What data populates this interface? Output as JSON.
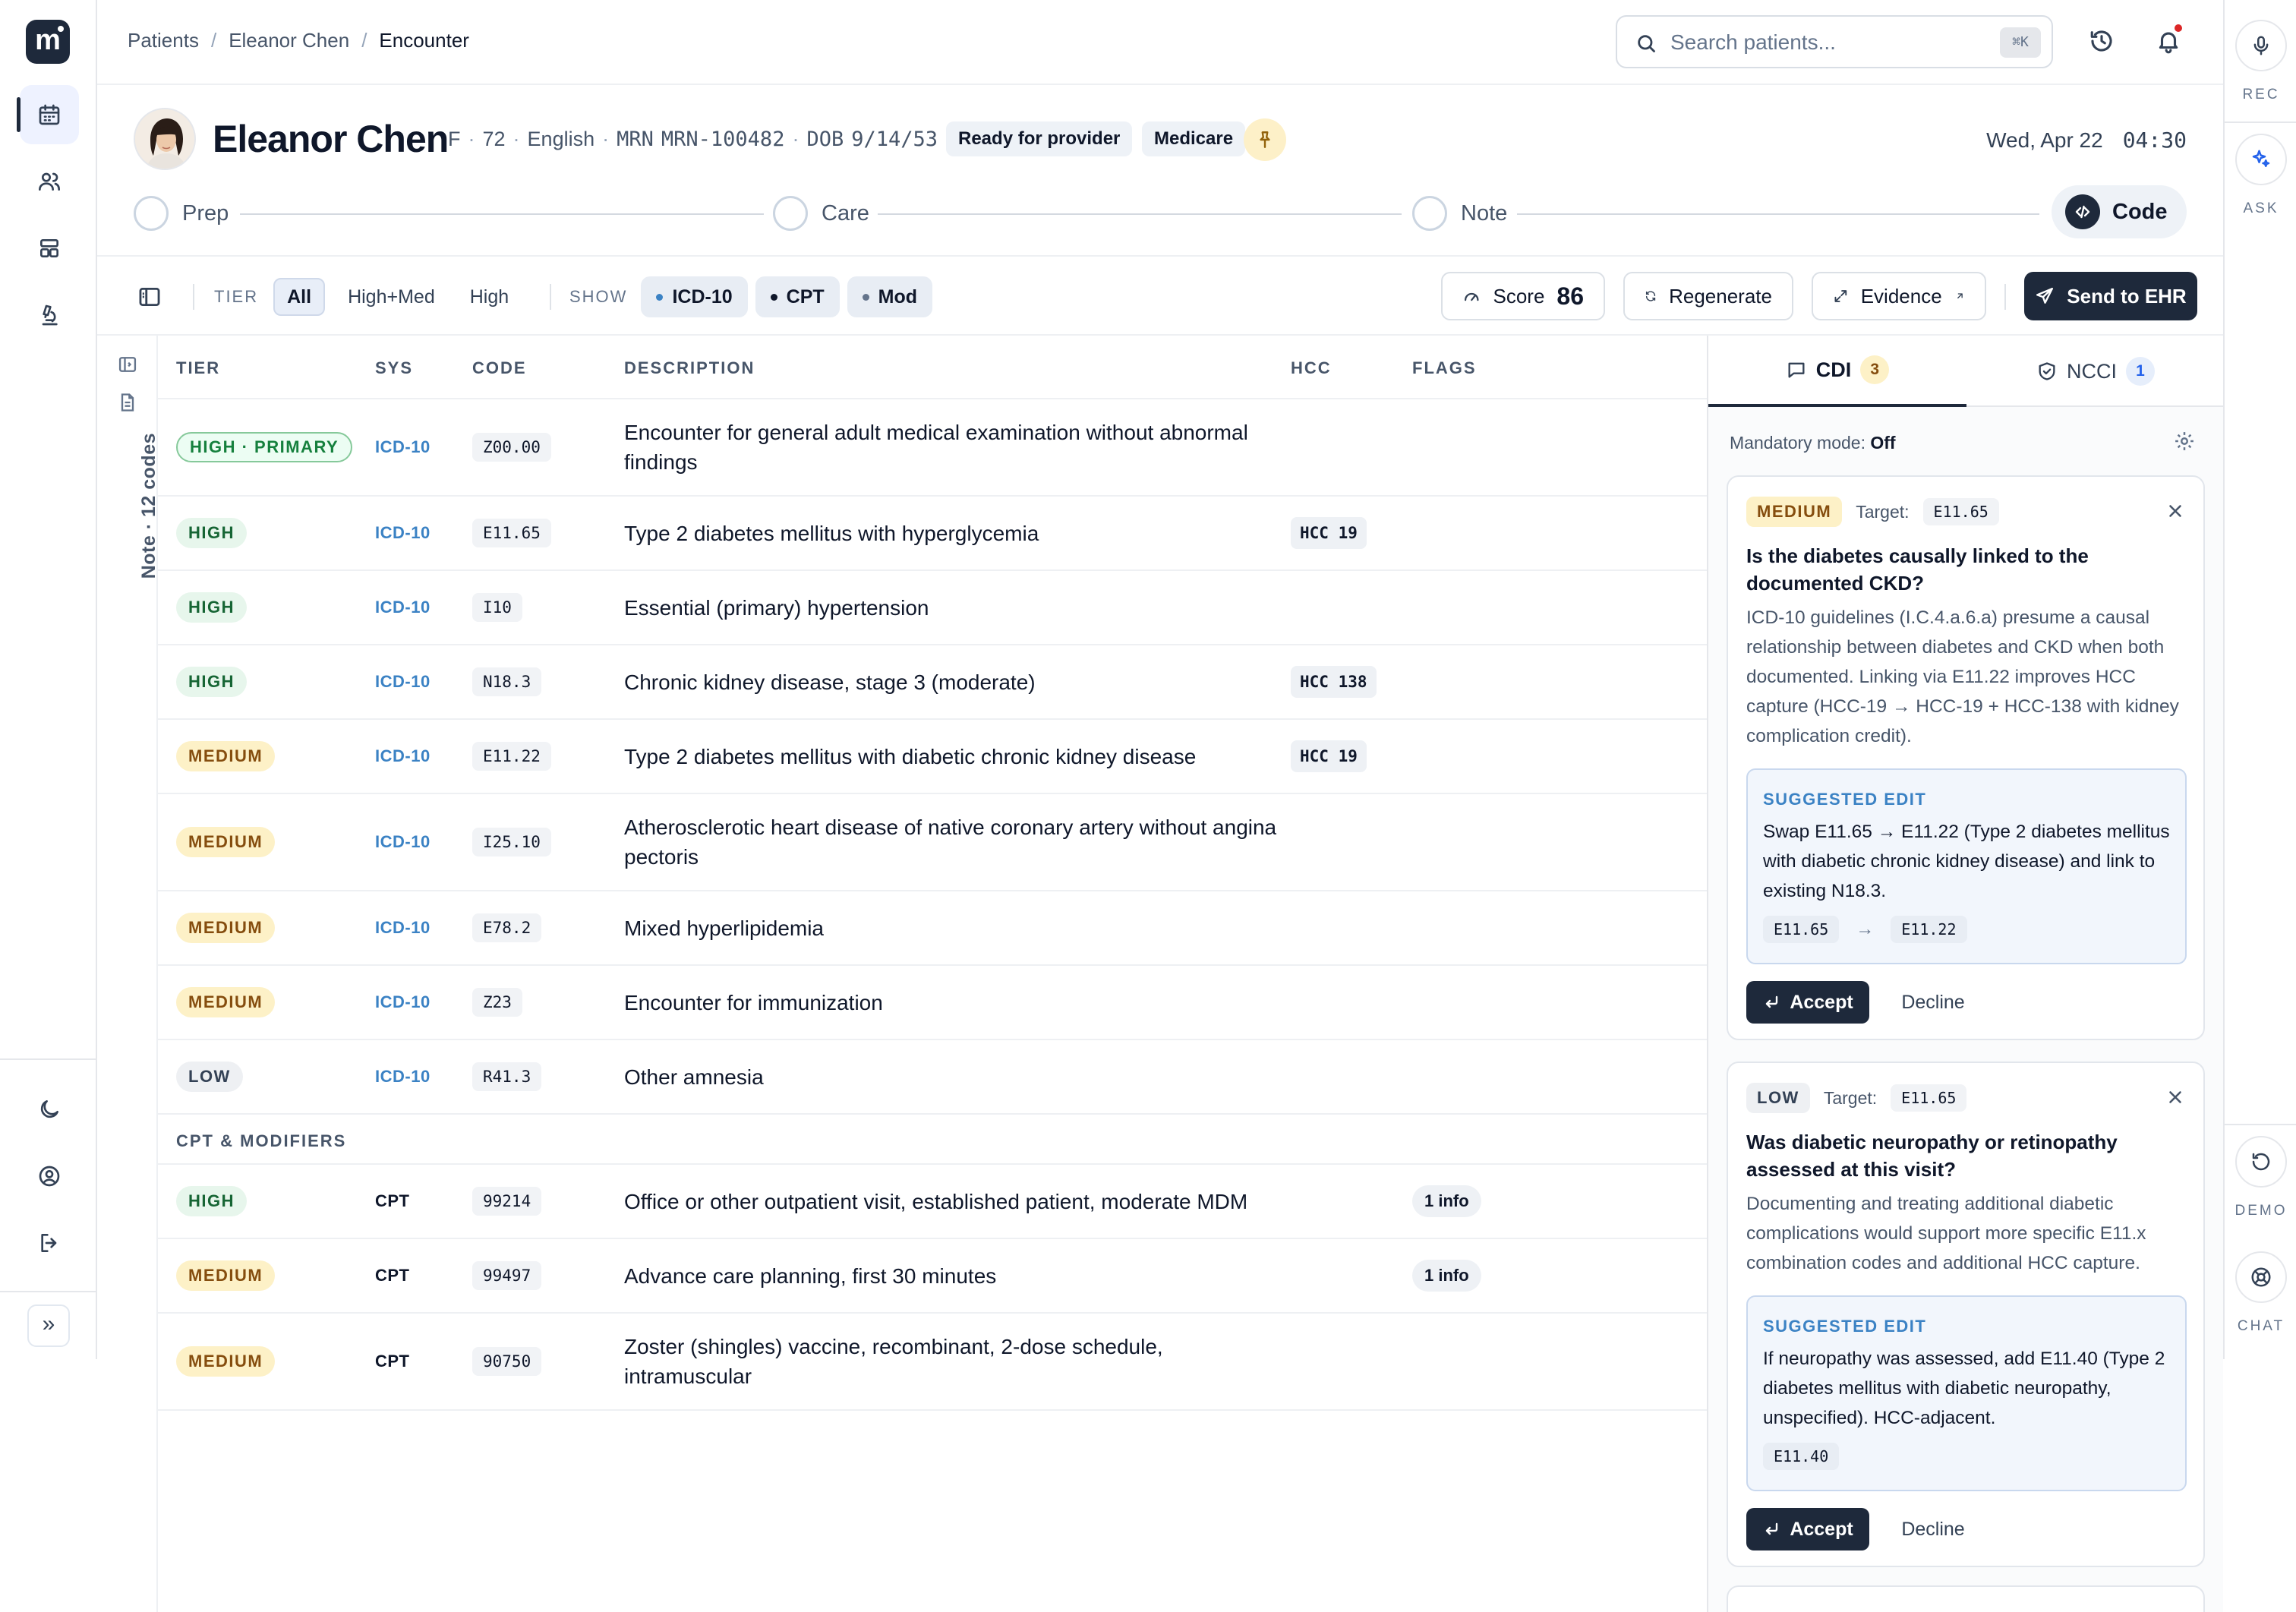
{
  "app": {
    "logo_letter": "m"
  },
  "breadcrumb": [
    "Patients",
    "Eleanor Chen",
    "Encounter"
  ],
  "search": {
    "placeholder": "Search patients...",
    "shortcut": "⌘K"
  },
  "patient": {
    "name": "Eleanor Chen",
    "sex": "F",
    "age": "72",
    "language": "English",
    "mrn_label": "MRN",
    "mrn": "MRN-100482",
    "dob_label": "DOB",
    "dob": "9/14/53",
    "status_badge": "Ready for provider",
    "payer_badge": "Medicare",
    "date": "Wed, Apr 22",
    "time": "04:30"
  },
  "workflow_steps": [
    {
      "label": "Prep",
      "state": "todo"
    },
    {
      "label": "Care",
      "state": "todo"
    },
    {
      "label": "Note",
      "state": "todo"
    },
    {
      "label": "Code",
      "state": "current"
    }
  ],
  "toolbar": {
    "tier_label": "TIER",
    "tier_options": [
      "All",
      "High+Med",
      "High"
    ],
    "tier_selected": "All",
    "show_label": "SHOW",
    "show_chips": [
      {
        "label": "ICD-10",
        "color": "#3b82c4"
      },
      {
        "label": "CPT",
        "color": "#0f172a"
      },
      {
        "label": "Mod",
        "color": "#64748b"
      }
    ],
    "score_label": "Score",
    "score_value": "86",
    "regenerate_label": "Regenerate",
    "evidence_label": "Evidence",
    "send_label": "Send to EHR"
  },
  "note_strip": {
    "label": "Note · 12 codes"
  },
  "table": {
    "headers": [
      "TIER",
      "SYS",
      "CODE",
      "DESCRIPTION",
      "HCC",
      "FLAGS"
    ],
    "icd_rows": [
      {
        "tier": "HIGH · PRIMARY",
        "tier_kind": "primary",
        "sys": "ICD-10",
        "code": "Z00.00",
        "description": "Encounter for general adult medical examination without abnormal findings",
        "hcc": "",
        "flag": ""
      },
      {
        "tier": "HIGH",
        "tier_kind": "high",
        "sys": "ICD-10",
        "code": "E11.65",
        "description": "Type 2 diabetes mellitus with hyperglycemia",
        "hcc": "HCC 19",
        "flag": ""
      },
      {
        "tier": "HIGH",
        "tier_kind": "high",
        "sys": "ICD-10",
        "code": "I10",
        "description": "Essential (primary) hypertension",
        "hcc": "",
        "flag": ""
      },
      {
        "tier": "HIGH",
        "tier_kind": "high",
        "sys": "ICD-10",
        "code": "N18.3",
        "description": "Chronic kidney disease, stage 3 (moderate)",
        "hcc": "HCC 138",
        "flag": ""
      },
      {
        "tier": "MEDIUM",
        "tier_kind": "medium",
        "sys": "ICD-10",
        "code": "E11.22",
        "description": "Type 2 diabetes mellitus with diabetic chronic kidney disease",
        "hcc": "HCC 19",
        "flag": ""
      },
      {
        "tier": "MEDIUM",
        "tier_kind": "medium",
        "sys": "ICD-10",
        "code": "I25.10",
        "description": "Atherosclerotic heart disease of native coronary artery without angina pectoris",
        "hcc": "",
        "flag": ""
      },
      {
        "tier": "MEDIUM",
        "tier_kind": "medium",
        "sys": "ICD-10",
        "code": "E78.2",
        "description": "Mixed hyperlipidemia",
        "hcc": "",
        "flag": ""
      },
      {
        "tier": "MEDIUM",
        "tier_kind": "medium",
        "sys": "ICD-10",
        "code": "Z23",
        "description": "Encounter for immunization",
        "hcc": "",
        "flag": ""
      },
      {
        "tier": "LOW",
        "tier_kind": "low",
        "sys": "ICD-10",
        "code": "R41.3",
        "description": "Other amnesia",
        "hcc": "",
        "flag": ""
      }
    ],
    "cpt_section_label": "CPT & MODIFIERS",
    "cpt_rows": [
      {
        "tier": "HIGH",
        "tier_kind": "high",
        "sys": "CPT",
        "code": "99214",
        "description": "Office or other outpatient visit, established patient, moderate MDM",
        "hcc": "",
        "flag": "1 info"
      },
      {
        "tier": "MEDIUM",
        "tier_kind": "medium",
        "sys": "CPT",
        "code": "99497",
        "description": "Advance care planning, first 30 minutes",
        "hcc": "",
        "flag": "1 info"
      },
      {
        "tier": "MEDIUM",
        "tier_kind": "medium",
        "sys": "CPT",
        "code": "90750",
        "description": "Zoster (shingles) vaccine, recombinant, 2-dose schedule, intramuscular",
        "hcc": "",
        "flag": ""
      }
    ]
  },
  "panel": {
    "tabs": [
      {
        "label": "CDI",
        "count": "3",
        "active": true
      },
      {
        "label": "NCCI",
        "count": "1",
        "active": false
      }
    ],
    "mandatory_label": "Mandatory mode:",
    "mandatory_value": "Off",
    "cards": [
      {
        "tier": "MEDIUM",
        "target_label": "Target:",
        "target_code": "E11.65",
        "question": "Is the diabetes causally linked to the documented CKD?",
        "body": "ICD-10 guidelines (I.C.4.a.6.a) presume a causal relationship between diabetes and CKD when both documented. Linking via E11.22 improves HCC capture (HCC-19 → HCC-19 + HCC-138 with kidney complication credit).",
        "suggest_label": "SUGGESTED EDIT",
        "suggest_text": "Swap E11.65 → E11.22 (Type 2 diabetes mellitus with diabetic chronic kidney disease) and link to existing N18.3.",
        "suggest_from": "E11.65",
        "suggest_arrow": "→",
        "suggest_to": "E11.22",
        "accept_label": "Accept",
        "decline_label": "Decline"
      },
      {
        "tier": "LOW",
        "target_label": "Target:",
        "target_code": "E11.65",
        "question": "Was diabetic neuropathy or retinopathy assessed at this visit?",
        "body": "Documenting and treating additional diabetic complications would support more specific E11.x combination codes and additional HCC capture.",
        "suggest_label": "SUGGESTED EDIT",
        "suggest_text": "If neuropathy was assessed, add E11.40 (Type 2 diabetes mellitus with diabetic neuropathy, unspecified). HCC-adjacent.",
        "suggest_code": "E11.40",
        "accept_label": "Accept",
        "decline_label": "Decline"
      }
    ]
  },
  "right_rail": {
    "rec_label": "REC",
    "ask_label": "ASK",
    "demo_label": "DEMO",
    "chat_label": "CHAT"
  },
  "icons": {
    "nav": [
      "calendar-icon",
      "users-icon",
      "layout-icon",
      "microscope-icon"
    ],
    "nav_bottom": [
      "moon-icon",
      "user-circle-icon",
      "logout-icon"
    ],
    "top": [
      "search-icon",
      "history-icon",
      "bell-icon"
    ]
  }
}
